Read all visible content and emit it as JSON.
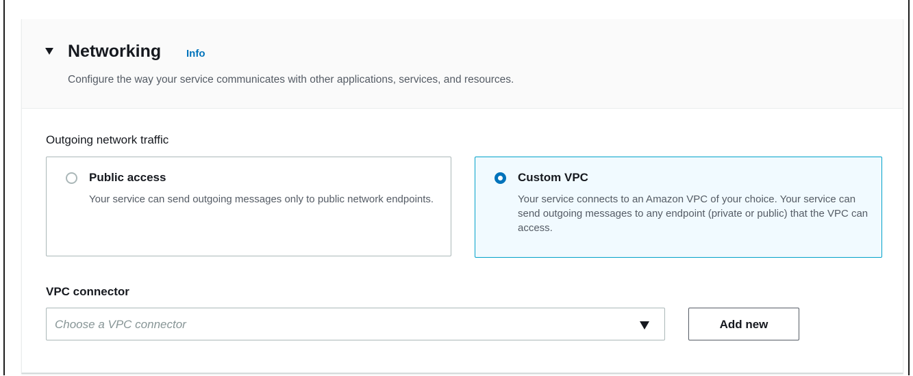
{
  "section": {
    "title": "Networking",
    "info_link": "Info",
    "description": "Configure the way your service communicates with other applications, services, and resources."
  },
  "outgoing_traffic": {
    "label": "Outgoing network traffic",
    "options": [
      {
        "title": "Public access",
        "description": "Your service can send outgoing messages only to public network endpoints.",
        "selected": false
      },
      {
        "title": "Custom VPC",
        "description": "Your service connects to an Amazon VPC of your choice. Your service can send outgoing messages to any endpoint (private or public) that the VPC can access.",
        "selected": true
      }
    ]
  },
  "vpc_connector": {
    "label": "VPC connector",
    "placeholder": "Choose a VPC connector",
    "add_button": "Add new"
  },
  "colors": {
    "accent": "#0073bb",
    "selected_border": "#00a1c9",
    "selected_bg": "#f1faff",
    "header_bg": "#fafafa"
  },
  "icons": {
    "section_toggle": "caret-down-icon",
    "dropdown": "caret-down-icon"
  }
}
